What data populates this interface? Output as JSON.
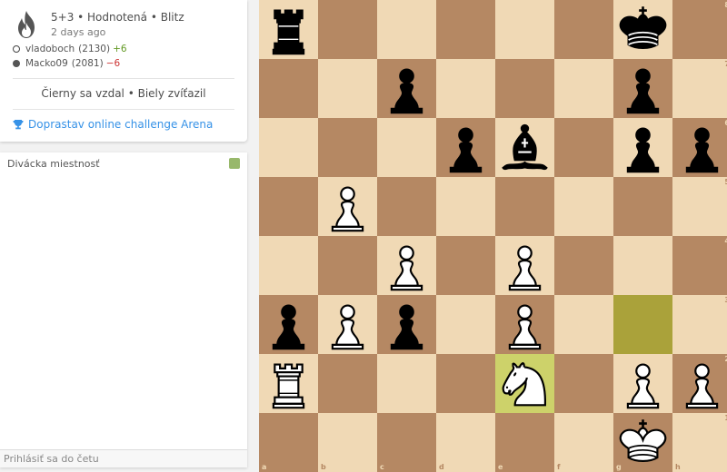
{
  "game": {
    "meta": "5+3 • Hodnotená • Blitz",
    "date": "2 days ago",
    "players": [
      {
        "color": "white",
        "name": "vladoboch",
        "rating": "(2130)",
        "diff": "+6",
        "diff_sign": "pos"
      },
      {
        "color": "black",
        "name": "Macko09",
        "rating": "(2081)",
        "diff": "−6",
        "diff_sign": "neg"
      }
    ],
    "result": "Čierny sa vzdal • Biely zvíťazil",
    "arena_link": "Doprastav online challenge Arena",
    "icon": "flame-icon"
  },
  "chat": {
    "title": "Divácka miestnosť",
    "placeholder": "Prihlásiť sa do četu",
    "toggle_color": "#98b86b"
  },
  "board": {
    "orientation": "white",
    "files": [
      "a",
      "b",
      "c",
      "d",
      "e",
      "f",
      "g",
      "h"
    ],
    "ranks": [
      "8",
      "7",
      "6",
      "5",
      "4",
      "3",
      "2",
      "1"
    ],
    "highlight_squares": [
      "e2",
      "g3"
    ],
    "colors": {
      "light": "#f0d9b5",
      "dark": "#b58863",
      "hl_light": "#cdd26a",
      "hl_dark": "#aaa23a"
    },
    "pieces": [
      {
        "square": "a8",
        "type": "rook",
        "color": "black"
      },
      {
        "square": "g8",
        "type": "king",
        "color": "black"
      },
      {
        "square": "c7",
        "type": "pawn",
        "color": "black"
      },
      {
        "square": "g7",
        "type": "pawn",
        "color": "black"
      },
      {
        "square": "d6",
        "type": "pawn",
        "color": "black"
      },
      {
        "square": "e6",
        "type": "bishop",
        "color": "black"
      },
      {
        "square": "g6",
        "type": "pawn",
        "color": "black"
      },
      {
        "square": "h6",
        "type": "pawn",
        "color": "black"
      },
      {
        "square": "b5",
        "type": "pawn",
        "color": "white"
      },
      {
        "square": "c4",
        "type": "pawn",
        "color": "white"
      },
      {
        "square": "e4",
        "type": "pawn",
        "color": "white"
      },
      {
        "square": "a3",
        "type": "pawn",
        "color": "black"
      },
      {
        "square": "b3",
        "type": "pawn",
        "color": "white"
      },
      {
        "square": "c3",
        "type": "pawn",
        "color": "black"
      },
      {
        "square": "e3",
        "type": "pawn",
        "color": "white"
      },
      {
        "square": "a2",
        "type": "rook",
        "color": "white"
      },
      {
        "square": "e2",
        "type": "knight",
        "color": "white"
      },
      {
        "square": "g2",
        "type": "pawn",
        "color": "white"
      },
      {
        "square": "h2",
        "type": "pawn",
        "color": "white"
      },
      {
        "square": "g1",
        "type": "king",
        "color": "white"
      }
    ]
  }
}
